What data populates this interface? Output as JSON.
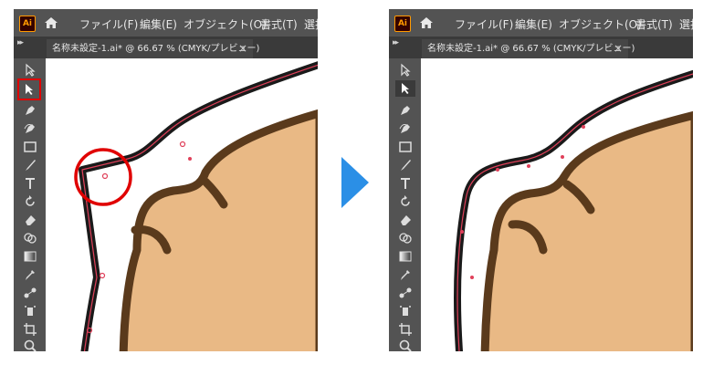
{
  "app": {
    "logo": "Ai"
  },
  "menu": [
    "ファイル(F)",
    "編集(E)",
    "オブジェクト(O)",
    "書式(T)",
    "選択"
  ],
  "tab": {
    "title": "名称未設定-1.ai* @ 66.67 % (CMYK/プレビュー)",
    "close": "×"
  },
  "tools": [
    "direct-selection-tool",
    "selection-tool",
    "pen-tool",
    "curvature-tool",
    "rectangle-tool",
    "paintbrush-tool",
    "type-tool",
    "rotate-tool",
    "eraser-tool",
    "shape-builder-tool",
    "gradient-tool",
    "eyedropper-tool",
    "blend-tool",
    "symbol-sprayer-tool",
    "artboard-tool",
    "zoom-tool"
  ],
  "colors": {
    "chrome": "#535353",
    "tabbar": "#3a3a3a",
    "fur": "#e9b985",
    "outline": "#5a3a1c",
    "path": "#e0405a",
    "highlight": "#e00000",
    "arrow": "#2b8fe6"
  },
  "steps": [
    {
      "highlighted_tool": "selection-tool",
      "callout": "red-circle-around-corner"
    },
    {
      "highlighted_tool": "selection-tool",
      "callout": "none"
    }
  ]
}
